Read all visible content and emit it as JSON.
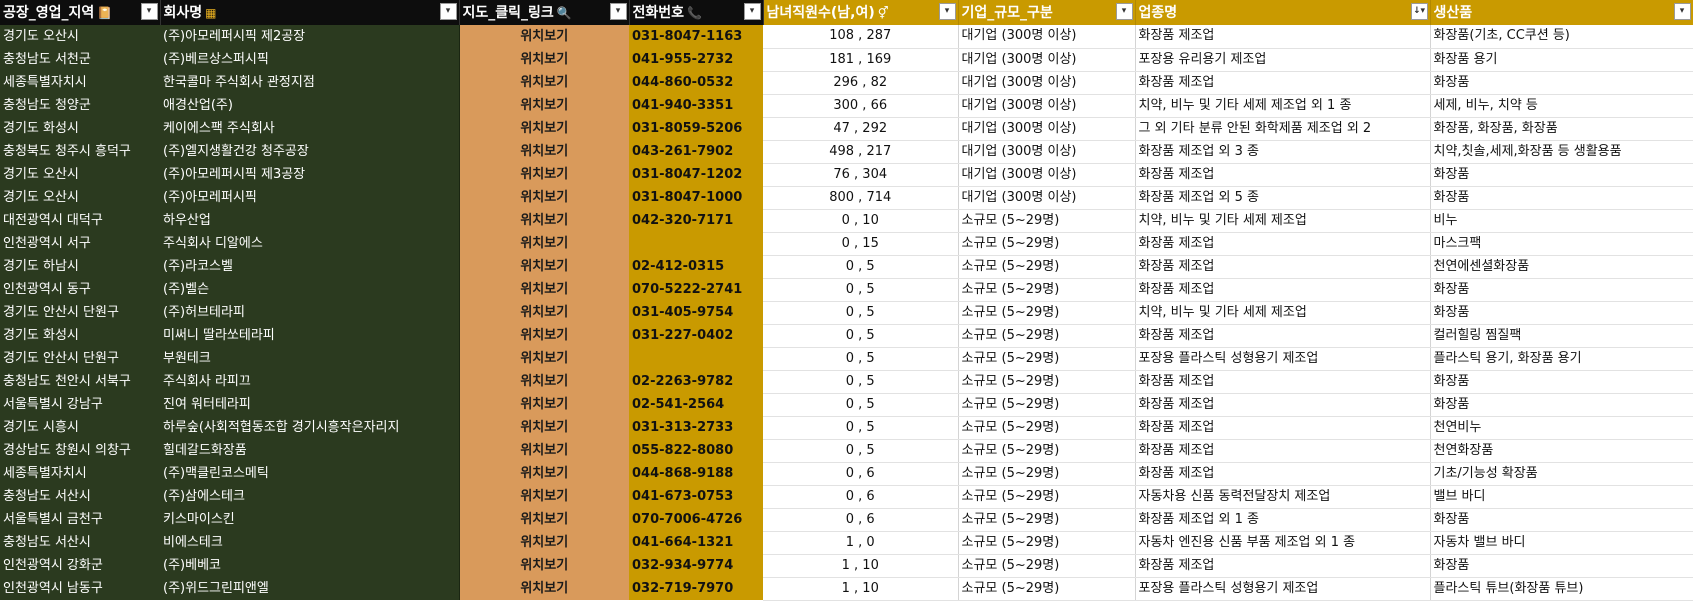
{
  "headers": [
    {
      "label": "공장_영업_지역",
      "icon": "📔",
      "icon_name": "book-icon",
      "filter": "▾"
    },
    {
      "label": "회사명",
      "icon": "▦",
      "icon_name": "building-icon",
      "filter": "▾"
    },
    {
      "label": "지도_클릭_링크",
      "icon": "🔍",
      "icon_name": "search-icon",
      "filter": "▾"
    },
    {
      "label": "전화번호",
      "icon": "📞",
      "icon_name": "phone-icon",
      "filter": "▾"
    },
    {
      "label": "남녀직원수(남,여)",
      "icon": "⚥",
      "icon_name": "gender-icon",
      "filter": "▾"
    },
    {
      "label": "기업_규모_구분",
      "icon": "",
      "icon_name": "",
      "filter": "▾"
    },
    {
      "label": "업종명",
      "icon": "",
      "icon_name": "",
      "filter": "↓▾"
    },
    {
      "label": "생산품",
      "icon": "",
      "icon_name": "",
      "filter": "▾"
    }
  ],
  "rows": [
    {
      "region": "경기도 오산시",
      "company": "(주)아모레퍼시픽 제2공장",
      "map": "위치보기",
      "phone": "031-8047-1163",
      "staff": "108 , 287",
      "size": "대기업 (300명 이상)",
      "industry": "화장품 제조업",
      "product": "화장품(기초, CC쿠션 등)"
    },
    {
      "region": "충청남도 서천군",
      "company": "(주)베르상스퍼시픽",
      "map": "위치보기",
      "phone": "041-955-2732",
      "staff": "181 , 169",
      "size": "대기업 (300명 이상)",
      "industry": "포장용 유리용기 제조업",
      "product": "화장품 용기"
    },
    {
      "region": "세종특별자치시",
      "company": "한국콜마 주식회사 관정지점",
      "map": "위치보기",
      "phone": "044-860-0532",
      "staff": "296 , 82",
      "size": "대기업 (300명 이상)",
      "industry": "화장품 제조업",
      "product": "화장품"
    },
    {
      "region": "충청남도 청양군",
      "company": "애경산업(주)",
      "map": "위치보기",
      "phone": "041-940-3351",
      "staff": "300 , 66",
      "size": "대기업 (300명 이상)",
      "industry": "치약, 비누 및 기타 세제 제조업 외 1 종",
      "product": "세제, 비누, 치약 등"
    },
    {
      "region": "경기도 화성시",
      "company": "케이에스팩 주식회사",
      "map": "위치보기",
      "phone": "031-8059-5206",
      "staff": "47 , 292",
      "size": "대기업 (300명 이상)",
      "industry": "그 외 기타 분류 안된 화학제품 제조업 외 2",
      "product": "화장품, 화장품, 화장품"
    },
    {
      "region": "충청북도 청주시 흥덕구",
      "company": "(주)엘지생활건강 청주공장",
      "map": "위치보기",
      "phone": "043-261-7902",
      "staff": "498 , 217",
      "size": "대기업 (300명 이상)",
      "industry": "화장품 제조업 외 3 종",
      "product": "치약,칫솔,세제,화장품 등 생활용품"
    },
    {
      "region": "경기도 오산시",
      "company": "(주)아모레퍼시픽 제3공장",
      "map": "위치보기",
      "phone": "031-8047-1202",
      "staff": "76 , 304",
      "size": "대기업 (300명 이상)",
      "industry": "화장품 제조업",
      "product": "화장품"
    },
    {
      "region": "경기도 오산시",
      "company": "(주)아모레퍼시픽",
      "map": "위치보기",
      "phone": "031-8047-1000",
      "staff": "800 , 714",
      "size": "대기업 (300명 이상)",
      "industry": "화장품 제조업 외 5 종",
      "product": "화장품"
    },
    {
      "region": "대전광역시 대덕구",
      "company": "하우산업",
      "map": "위치보기",
      "phone": "042-320-7171",
      "staff": "0 , 10",
      "size": "소규모 (5~29명)",
      "industry": "치약, 비누 및 기타 세제 제조업",
      "product": "비누"
    },
    {
      "region": "인천광역시 서구",
      "company": "주식회사 디알에스",
      "map": "위치보기",
      "phone": "",
      "staff": "0 , 15",
      "size": "소규모 (5~29명)",
      "industry": "화장품 제조업",
      "product": "마스크팩"
    },
    {
      "region": "경기도 하남시",
      "company": "(주)라코스벨",
      "map": "위치보기",
      "phone": "02-412-0315",
      "staff": "0 , 5",
      "size": "소규모 (5~29명)",
      "industry": "화장품 제조업",
      "product": "천연에센셜화장품"
    },
    {
      "region": "인천광역시 동구",
      "company": "(주)벨슨",
      "map": "위치보기",
      "phone": "070-5222-2741",
      "staff": "0 , 5",
      "size": "소규모 (5~29명)",
      "industry": "화장품 제조업",
      "product": "화장품"
    },
    {
      "region": "경기도 안산시 단원구",
      "company": "(주)허브테라피",
      "map": "위치보기",
      "phone": "031-405-9754",
      "staff": "0 , 5",
      "size": "소규모 (5~29명)",
      "industry": "치약, 비누 및 기타 세제 제조업",
      "product": "화장품"
    },
    {
      "region": "경기도 화성시",
      "company": "미써니 딸라쏘테라피",
      "map": "위치보기",
      "phone": "031-227-0402",
      "staff": "0 , 5",
      "size": "소규모 (5~29명)",
      "industry": "화장품 제조업",
      "product": "컬러힐링 찜질팩"
    },
    {
      "region": "경기도 안산시 단원구",
      "company": "부원테크",
      "map": "위치보기",
      "phone": "",
      "staff": "0 , 5",
      "size": "소규모 (5~29명)",
      "industry": "포장용 플라스틱 성형용기 제조업",
      "product": "플라스틱 용기, 화장품 용기"
    },
    {
      "region": "충청남도 천안시 서북구",
      "company": "주식회사 라피끄",
      "map": "위치보기",
      "phone": "02-2263-9782",
      "staff": "0 , 5",
      "size": "소규모 (5~29명)",
      "industry": "화장품 제조업",
      "product": "화장품"
    },
    {
      "region": "서울특별시 강남구",
      "company": "진여 워터테라피",
      "map": "위치보기",
      "phone": "02-541-2564",
      "staff": "0 , 5",
      "size": "소규모 (5~29명)",
      "industry": "화장품 제조업",
      "product": "화장품"
    },
    {
      "region": "경기도 시흥시",
      "company": "하루숲(사회적협동조합 경기시흥작은자리지",
      "map": "위치보기",
      "phone": "031-313-2733",
      "staff": "0 , 5",
      "size": "소규모 (5~29명)",
      "industry": "화장품 제조업",
      "product": "천연비누"
    },
    {
      "region": "경상남도 창원시 의창구",
      "company": "힐데갈드화장품",
      "map": "위치보기",
      "phone": "055-822-8080",
      "staff": "0 , 5",
      "size": "소규모 (5~29명)",
      "industry": "화장품 제조업",
      "product": "천연화장품"
    },
    {
      "region": "세종특별자치시",
      "company": "(주)맥클린코스메틱",
      "map": "위치보기",
      "phone": "044-868-9188",
      "staff": "0 , 6",
      "size": "소규모 (5~29명)",
      "industry": "화장품 제조업",
      "product": "기초/기능성 확장품"
    },
    {
      "region": "충청남도 서산시",
      "company": "(주)삼에스테크",
      "map": "위치보기",
      "phone": "041-673-0753",
      "staff": "0 , 6",
      "size": "소규모 (5~29명)",
      "industry": "자동차용 신품 동력전달장치 제조업",
      "product": "밸브 바디"
    },
    {
      "region": "서울특별시 금천구",
      "company": "키스마이스킨",
      "map": "위치보기",
      "phone": "070-7006-4726",
      "staff": "0 , 6",
      "size": "소규모 (5~29명)",
      "industry": "화장품 제조업 외 1 종",
      "product": "화장품"
    },
    {
      "region": "충청남도 서산시",
      "company": "비에스테크",
      "map": "위치보기",
      "phone": "041-664-1321",
      "staff": "1 , 0",
      "size": "소규모 (5~29명)",
      "industry": "자동차 엔진용 신품 부품 제조업 외 1 종",
      "product": "자동차 밸브 바디"
    },
    {
      "region": "인천광역시 강화군",
      "company": "(주)베베코",
      "map": "위치보기",
      "phone": "032-934-9774",
      "staff": "1 , 10",
      "size": "소규모 (5~29명)",
      "industry": "화장품 제조업",
      "product": "화장품"
    },
    {
      "region": "인천광역시 남동구",
      "company": "(주)위드그린피앤엘",
      "map": "위치보기",
      "phone": "032-719-7970",
      "staff": "1 , 10",
      "size": "소규모 (5~29명)",
      "industry": "포장용 플라스틱 성형용기 제조업",
      "product": "플라스틱 튜브(화장품 튜브)"
    }
  ]
}
